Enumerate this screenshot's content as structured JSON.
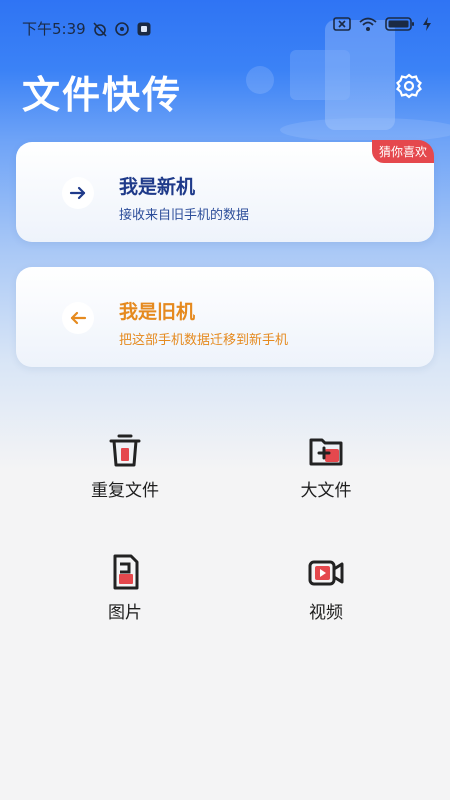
{
  "status_bar": {
    "time": "下午5:39"
  },
  "header": {
    "title": "文件快传",
    "settings_icon": "gear-icon"
  },
  "cards": {
    "new_phone": {
      "title": "我是新机",
      "subtitle": "接收来自旧手机的数据",
      "badge": "猜你喜欢",
      "icon": "arrow-right-icon"
    },
    "old_phone": {
      "title": "我是旧机",
      "subtitle": "把这部手机数据迁移到新手机",
      "icon": "arrow-left-icon"
    }
  },
  "tools": [
    {
      "label": "重复文件",
      "icon": "trash-icon"
    },
    {
      "label": "大文件",
      "icon": "folder-plus-icon"
    },
    {
      "label": "图片",
      "icon": "sd-card-icon"
    },
    {
      "label": "视频",
      "icon": "video-camera-icon"
    }
  ],
  "colors": {
    "primary": "#2f74f4",
    "new_card_text": "#1f3a8a",
    "old_card_text": "#e58a1f",
    "badge": "#e5484d",
    "icon_accent": "#e5484d"
  }
}
